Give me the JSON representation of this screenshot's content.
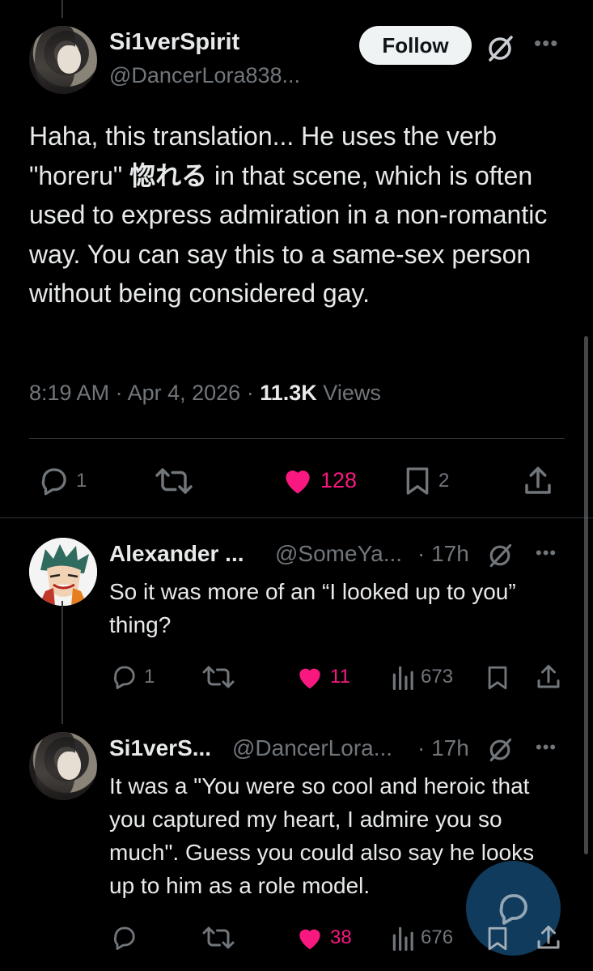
{
  "main_tweet": {
    "display_name": "Si1verSpirit",
    "handle": "@DancerLora838...",
    "follow_label": "Follow",
    "body_before": "Haha, this translation... He uses the verb \"horeru\" ",
    "body_kanji": "惚れる",
    "body_after": "  in that scene, which is often used to express admiration in a non-romantic way. You can say this to a same-sex person without being considered gay.",
    "time": "8:19 AM",
    "date": "Apr 4, 2026",
    "views_count": "11.3K",
    "views_label": "Views",
    "replies": "1",
    "likes": "128",
    "bookmarks": "2"
  },
  "reply_1": {
    "display_name": "Alexander ...",
    "handle": "@SomeYa...",
    "time": "· 17h",
    "body": "So it was more of an “I looked up to you” thing?",
    "replies": "1",
    "likes": "11",
    "views": "673"
  },
  "reply_2": {
    "display_name": "Si1verS...",
    "handle": "@DancerLora...",
    "time": "· 17h",
    "body": "It was a \"You were so cool and heroic that you captured my heart, I admire you so much\". Guess you could also say he looks up to him as a role model.",
    "likes": "38",
    "views": "676"
  },
  "colors": {
    "background": "#000000",
    "text": "#e7e9ea",
    "muted": "#71767b",
    "like": "#f91880",
    "fab": "#1d6ca8"
  },
  "icons": [
    "grok-icon",
    "more-icon",
    "reply-icon",
    "repost-icon",
    "like-icon",
    "bookmark-icon",
    "share-icon",
    "views-icon",
    "compose-icon"
  ]
}
